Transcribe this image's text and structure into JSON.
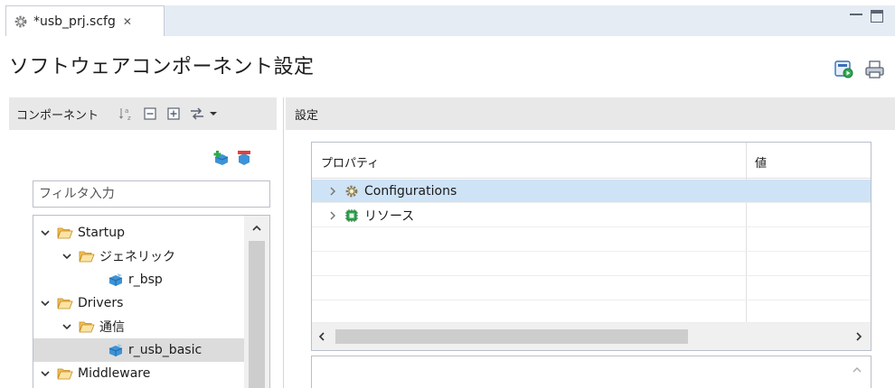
{
  "tab": {
    "title": "*usb_prj.scfg",
    "close_glyph": "✕",
    "icon": "gear-icon"
  },
  "window": {
    "minimize_icon": "minimize-icon",
    "maximize_icon": "maximize-icon"
  },
  "page": {
    "title": "ソフトウェアコンポーネント設定"
  },
  "toolbar": {
    "icons": [
      "generate-code-icon",
      "print-icon"
    ]
  },
  "left_panel": {
    "title": "コンポーネント",
    "header_icons": [
      "sort-alpha-icon",
      "collapse-all-icon",
      "expand-all-icon",
      "link-icon",
      "dropdown-arrow-icon"
    ],
    "action_icons": [
      "add-component-icon",
      "remove-component-icon"
    ],
    "filter": {
      "placeholder": "フィルタ入力",
      "value": ""
    },
    "tree": [
      {
        "label": "Startup",
        "level": 0,
        "type": "folder",
        "expanded": true
      },
      {
        "label": "ジェネリック",
        "level": 1,
        "type": "folder",
        "expanded": true
      },
      {
        "label": "r_bsp",
        "level": 2,
        "type": "component"
      },
      {
        "label": "Drivers",
        "level": 0,
        "type": "folder",
        "expanded": true
      },
      {
        "label": "通信",
        "level": 1,
        "type": "folder",
        "expanded": true
      },
      {
        "label": "r_usb_basic",
        "level": 2,
        "type": "component",
        "selected": true
      },
      {
        "label": "Middleware",
        "level": 0,
        "type": "folder",
        "expanded": true
      }
    ]
  },
  "right_panel": {
    "title": "設定",
    "columns": [
      "プロパティ",
      "値"
    ],
    "rows": [
      {
        "label": "Configurations",
        "value": "",
        "icon": "gear-icon",
        "selected": true
      },
      {
        "label": "リソース",
        "value": "",
        "icon": "chip-icon",
        "selected": false
      }
    ]
  },
  "colors": {
    "selection_blue": "#cfe3f7",
    "selection_gray": "#dcdcdc",
    "folder": "#e2a93a",
    "component": "#2e8ad1"
  }
}
